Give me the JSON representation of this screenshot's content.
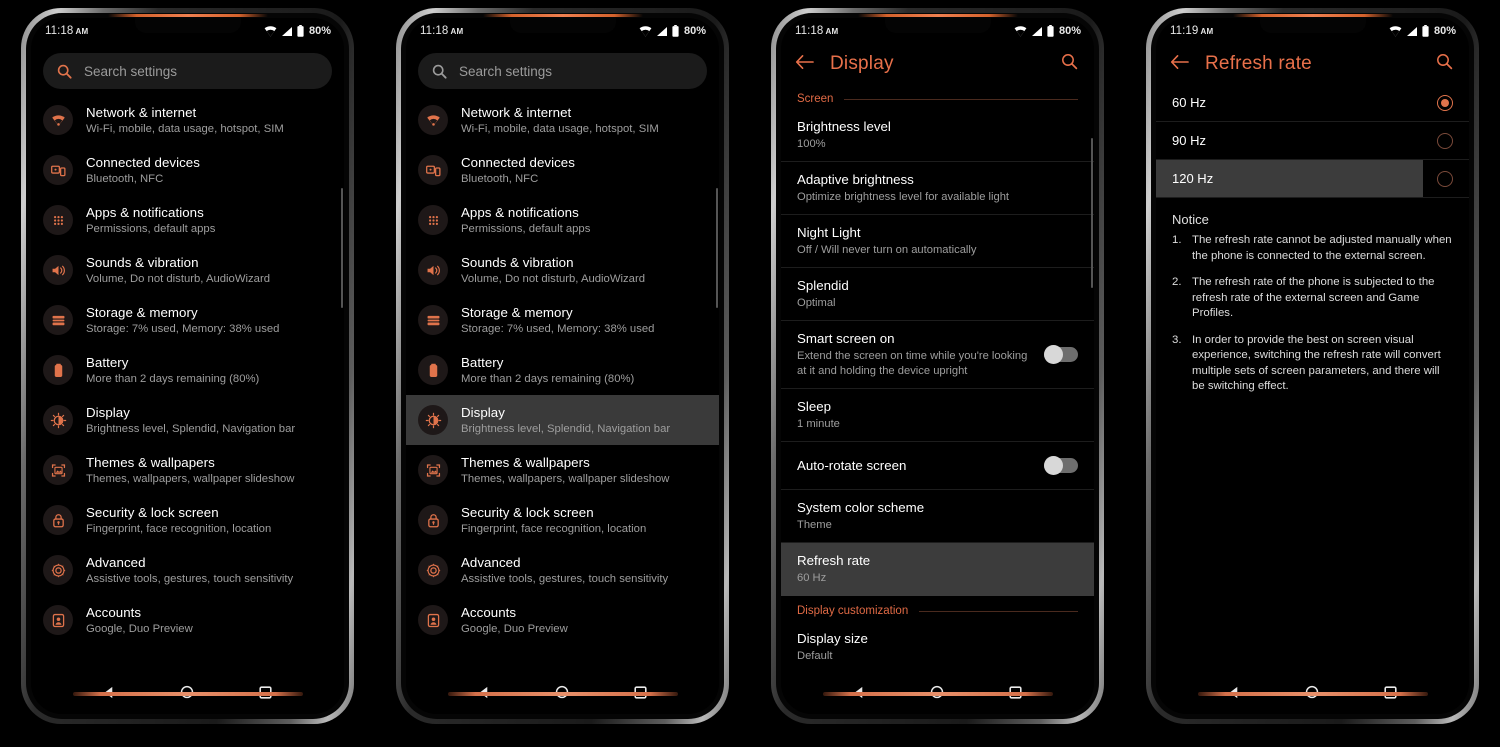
{
  "theme": {
    "accent": "#e0734b",
    "accent_header": "#e8704a",
    "background": "#000000",
    "selected_row": "#3c3c3c",
    "primary_text": "#ffffff",
    "secondary_text": "#9e9e9e"
  },
  "status_bar": {
    "time_118": "11:18",
    "time_119": "11:19",
    "ampm": "AM",
    "battery": "80%",
    "icons": [
      "wifi-icon",
      "signal-icon",
      "battery-icon"
    ]
  },
  "nav_bar": {
    "back": "back-triangle-icon",
    "home": "home-circle-icon",
    "recents": "recents-square-icon"
  },
  "search": {
    "placeholder": "Search settings",
    "icon": "search-icon"
  },
  "settings_list": [
    {
      "icon": "wifi-icon",
      "title": "Network & internet",
      "subtitle": "Wi-Fi, mobile, data usage, hotspot, SIM"
    },
    {
      "icon": "connected-devices-icon",
      "title": "Connected devices",
      "subtitle": "Bluetooth, NFC"
    },
    {
      "icon": "apps-grid-icon",
      "title": "Apps & notifications",
      "subtitle": "Permissions, default apps"
    },
    {
      "icon": "speaker-icon",
      "title": "Sounds & vibration",
      "subtitle": "Volume, Do not disturb, AudioWizard"
    },
    {
      "icon": "storage-icon",
      "title": "Storage & memory",
      "subtitle": "Storage: 7% used, Memory: 38% used"
    },
    {
      "icon": "battery-icon",
      "title": "Battery",
      "subtitle": "More than 2 days remaining (80%)"
    },
    {
      "icon": "brightness-icon",
      "title": "Display",
      "subtitle": "Brightness level, Splendid, Navigation bar"
    },
    {
      "icon": "wallpaper-icon",
      "title": "Themes & wallpapers",
      "subtitle": "Themes, wallpapers, wallpaper slideshow"
    },
    {
      "icon": "lock-icon",
      "title": "Security & lock screen",
      "subtitle": "Fingerprint, face recognition, location"
    },
    {
      "icon": "gear-icon",
      "title": "Advanced",
      "subtitle": "Assistive tools, gestures, touch sensitivity"
    },
    {
      "icon": "account-icon",
      "title": "Accounts",
      "subtitle": "Google, Duo Preview"
    }
  ],
  "display_screen": {
    "title": "Display",
    "back_icon": "back-arrow-icon",
    "search_icon": "search-icon",
    "sections": {
      "screen": "Screen",
      "customization": "Display customization"
    },
    "rows": [
      {
        "title": "Brightness level",
        "subtitle": "100%",
        "control": "none"
      },
      {
        "title": "Adaptive brightness",
        "subtitle": "Optimize brightness level for available light",
        "control": "none"
      },
      {
        "title": "Night Light",
        "subtitle": "Off / Will never turn on automatically",
        "control": "none"
      },
      {
        "title": "Splendid",
        "subtitle": "Optimal",
        "control": "none"
      },
      {
        "title": "Smart screen on",
        "subtitle": "Extend the screen on time while you're looking at it and holding the device upright",
        "control": "toggle",
        "toggle_on": false
      },
      {
        "title": "Sleep",
        "subtitle": "1 minute",
        "control": "none"
      },
      {
        "title": "Auto-rotate screen",
        "subtitle": "",
        "control": "toggle",
        "toggle_on": false
      },
      {
        "title": "System color scheme",
        "subtitle": "Theme",
        "control": "none"
      },
      {
        "title": "Refresh rate",
        "subtitle": "60 Hz",
        "control": "none",
        "selected": true
      }
    ],
    "custom_rows": [
      {
        "title": "Display size",
        "subtitle": "Default",
        "control": "none"
      }
    ]
  },
  "refresh_rate_screen": {
    "title": "Refresh rate",
    "back_icon": "back-arrow-icon",
    "search_icon": "search-icon",
    "options": [
      {
        "label": "60 Hz",
        "selected_radio": true,
        "highlighted": false
      },
      {
        "label": "90 Hz",
        "selected_radio": false,
        "highlighted": false
      },
      {
        "label": "120 Hz",
        "selected_radio": false,
        "highlighted": true
      }
    ],
    "notice_heading": "Notice",
    "notice_items": [
      {
        "num": "1.",
        "text": "The refresh rate cannot be adjusted manually when the phone is connected to the external screen."
      },
      {
        "num": "2.",
        "text": "The refresh rate of the phone is subjected to the refresh rate of the external screen and Game Profiles."
      },
      {
        "num": "3.",
        "text": "In order to provide the best on screen visual experience, switching the refresh rate will convert multiple sets of screen parameters, and there will be switching effect."
      }
    ]
  }
}
